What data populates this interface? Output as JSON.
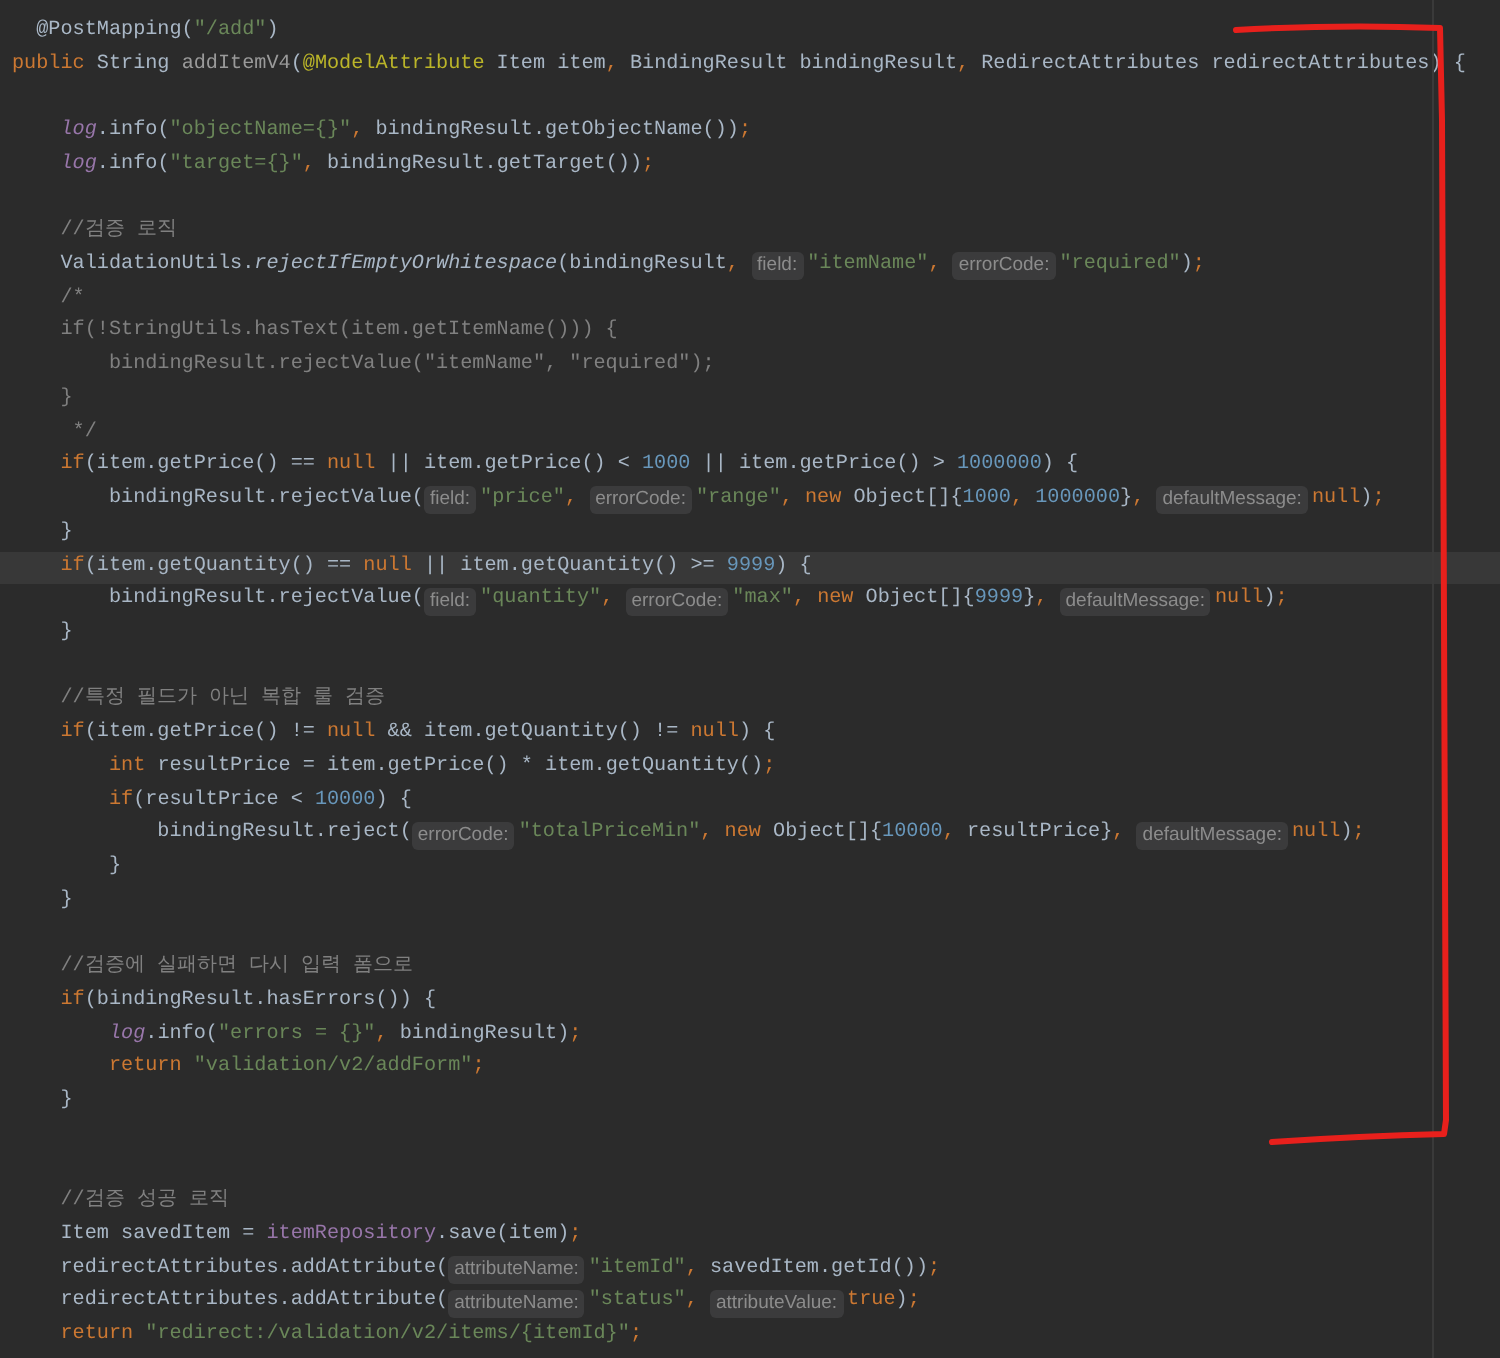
{
  "editor": {
    "lines": [
      {
        "current": false,
        "tokens": [
          {
            "kind": "plain",
            "text": "  @PostMapping("
          },
          {
            "kind": "str",
            "text": "\"/add\""
          },
          {
            "kind": "plain",
            "text": ")"
          }
        ]
      },
      {
        "current": false,
        "tokens": [
          {
            "kind": "kw",
            "text": "public"
          },
          {
            "kind": "plain",
            "text": " String "
          },
          {
            "kind": "dim",
            "text": "addItemV4"
          },
          {
            "kind": "plain",
            "text": "("
          },
          {
            "kind": "anno",
            "text": "@ModelAttribute"
          },
          {
            "kind": "plain",
            "text": " Item item"
          },
          {
            "kind": "kw",
            "text": ", "
          },
          {
            "kind": "plain",
            "text": "BindingResult bindingResult"
          },
          {
            "kind": "kw",
            "text": ", "
          },
          {
            "kind": "plain",
            "text": "RedirectAttributes redirectAttributes) {"
          }
        ]
      },
      {
        "current": false
      },
      {
        "current": false,
        "tokens": [
          {
            "kind": "field",
            "text": "    log"
          },
          {
            "kind": "plain",
            "text": ".info("
          },
          {
            "kind": "str",
            "text": "\"objectName={}\""
          },
          {
            "kind": "kw",
            "text": ", "
          },
          {
            "kind": "plain",
            "text": "bindingResult.getObjectName())"
          },
          {
            "kind": "kw",
            "text": ";"
          }
        ]
      },
      {
        "current": false,
        "tokens": [
          {
            "kind": "field",
            "text": "    log"
          },
          {
            "kind": "plain",
            "text": ".info("
          },
          {
            "kind": "str",
            "text": "\"target={}\""
          },
          {
            "kind": "kw",
            "text": ", "
          },
          {
            "kind": "plain",
            "text": "bindingResult.getTarget())"
          },
          {
            "kind": "kw",
            "text": ";"
          }
        ]
      },
      {
        "current": false
      },
      {
        "current": false,
        "tokens": [
          {
            "kind": "com",
            "text": "    //검증 로직"
          }
        ]
      },
      {
        "current": false,
        "tokens": [
          {
            "kind": "plain",
            "text": "    ValidationUtils."
          },
          {
            "kind": "italic",
            "text": "rejectIfEmptyOrWhitespace"
          },
          {
            "kind": "plain",
            "text": "(bindingResult"
          },
          {
            "kind": "kw",
            "text": ", "
          },
          {
            "kind": "hint",
            "text": "field:"
          },
          {
            "kind": "str",
            "text": "\"itemName\""
          },
          {
            "kind": "kw",
            "text": ", "
          },
          {
            "kind": "hint",
            "text": "errorCode:"
          },
          {
            "kind": "str",
            "text": "\"required\""
          },
          {
            "kind": "plain",
            "text": ")"
          },
          {
            "kind": "kw",
            "text": ";"
          }
        ]
      },
      {
        "current": false,
        "tokens": [
          {
            "kind": "com",
            "text": "    /*"
          }
        ]
      },
      {
        "current": false,
        "tokens": [
          {
            "kind": "com",
            "text": "    if(!StringUtils.hasText(item.getItemName())) {"
          }
        ]
      },
      {
        "current": false,
        "tokens": [
          {
            "kind": "com",
            "text": "        bindingResult.rejectValue(\"itemName\", \"required\");"
          }
        ]
      },
      {
        "current": false,
        "tokens": [
          {
            "kind": "com",
            "text": "    }"
          }
        ]
      },
      {
        "current": false,
        "tokens": [
          {
            "kind": "com",
            "text": "     */"
          }
        ]
      },
      {
        "current": false,
        "tokens": [
          {
            "kind": "kw",
            "text": "    if"
          },
          {
            "kind": "plain",
            "text": "(item.getPrice() == "
          },
          {
            "kind": "kw",
            "text": "null"
          },
          {
            "kind": "plain",
            "text": " || item.getPrice() < "
          },
          {
            "kind": "num",
            "text": "1000"
          },
          {
            "kind": "plain",
            "text": " || item.getPrice() > "
          },
          {
            "kind": "num",
            "text": "1000000"
          },
          {
            "kind": "plain",
            "text": ") {"
          }
        ]
      },
      {
        "current": false,
        "tokens": [
          {
            "kind": "plain",
            "text": "        bindingResult.rejectValue("
          },
          {
            "kind": "hint",
            "text": "field:"
          },
          {
            "kind": "str",
            "text": "\"price\""
          },
          {
            "kind": "kw",
            "text": ", "
          },
          {
            "kind": "hint",
            "text": "errorCode:"
          },
          {
            "kind": "str",
            "text": "\"range\""
          },
          {
            "kind": "kw",
            "text": ", new"
          },
          {
            "kind": "plain",
            "text": " Object[]{"
          },
          {
            "kind": "num",
            "text": "1000"
          },
          {
            "kind": "kw",
            "text": ", "
          },
          {
            "kind": "num",
            "text": "1000000"
          },
          {
            "kind": "plain",
            "text": "}"
          },
          {
            "kind": "kw",
            "text": ", "
          },
          {
            "kind": "hint",
            "text": "defaultMessage:"
          },
          {
            "kind": "kw",
            "text": "null"
          },
          {
            "kind": "plain",
            "text": ")"
          },
          {
            "kind": "kw",
            "text": ";"
          }
        ]
      },
      {
        "current": false,
        "tokens": [
          {
            "kind": "plain",
            "text": "    }"
          }
        ]
      },
      {
        "current": true,
        "tokens": [
          {
            "kind": "kw",
            "text": "    if"
          },
          {
            "kind": "plain",
            "text": "(item.getQuantity() == "
          },
          {
            "kind": "kw",
            "text": "null"
          },
          {
            "kind": "plain",
            "text": " || item.getQuantity() >= "
          },
          {
            "kind": "num",
            "text": "9999"
          },
          {
            "kind": "plain",
            "text": ") {"
          }
        ]
      },
      {
        "current": false,
        "tokens": [
          {
            "kind": "plain",
            "text": "        bindingResult.rejectValue("
          },
          {
            "kind": "hint",
            "text": "field:"
          },
          {
            "kind": "str",
            "text": "\"quantity\""
          },
          {
            "kind": "kw",
            "text": ", "
          },
          {
            "kind": "hint",
            "text": "errorCode:"
          },
          {
            "kind": "str",
            "text": "\"max\""
          },
          {
            "kind": "kw",
            "text": ", new"
          },
          {
            "kind": "plain",
            "text": " Object[]{"
          },
          {
            "kind": "num",
            "text": "9999"
          },
          {
            "kind": "plain",
            "text": "}"
          },
          {
            "kind": "kw",
            "text": ", "
          },
          {
            "kind": "hint",
            "text": "defaultMessage:"
          },
          {
            "kind": "kw",
            "text": "null"
          },
          {
            "kind": "plain",
            "text": ")"
          },
          {
            "kind": "kw",
            "text": ";"
          }
        ]
      },
      {
        "current": false,
        "tokens": [
          {
            "kind": "plain",
            "text": "    }"
          }
        ]
      },
      {
        "current": false
      },
      {
        "current": false,
        "tokens": [
          {
            "kind": "com",
            "text": "    //특정 필드가 아닌 복합 룰 검증"
          }
        ]
      },
      {
        "current": false,
        "tokens": [
          {
            "kind": "kw",
            "text": "    if"
          },
          {
            "kind": "plain",
            "text": "(item.getPrice() != "
          },
          {
            "kind": "kw",
            "text": "null"
          },
          {
            "kind": "plain",
            "text": " && item.getQuantity() != "
          },
          {
            "kind": "kw",
            "text": "null"
          },
          {
            "kind": "plain",
            "text": ") {"
          }
        ]
      },
      {
        "current": false,
        "tokens": [
          {
            "kind": "kw",
            "text": "        int"
          },
          {
            "kind": "plain",
            "text": " resultPrice = item.getPrice() * item.getQuantity()"
          },
          {
            "kind": "kw",
            "text": ";"
          }
        ]
      },
      {
        "current": false,
        "tokens": [
          {
            "kind": "kw",
            "text": "        if"
          },
          {
            "kind": "plain",
            "text": "(resultPrice < "
          },
          {
            "kind": "num",
            "text": "10000"
          },
          {
            "kind": "plain",
            "text": ") {"
          }
        ]
      },
      {
        "current": false,
        "tokens": [
          {
            "kind": "plain",
            "text": "            bindingResult.reject("
          },
          {
            "kind": "hint",
            "text": "errorCode:"
          },
          {
            "kind": "str",
            "text": "\"totalPriceMin\""
          },
          {
            "kind": "kw",
            "text": ", new"
          },
          {
            "kind": "plain",
            "text": " Object[]{"
          },
          {
            "kind": "num",
            "text": "10000"
          },
          {
            "kind": "kw",
            "text": ", "
          },
          {
            "kind": "plain",
            "text": "resultPrice}"
          },
          {
            "kind": "kw",
            "text": ", "
          },
          {
            "kind": "hint",
            "text": "defaultMessage:"
          },
          {
            "kind": "kw",
            "text": "null"
          },
          {
            "kind": "plain",
            "text": ")"
          },
          {
            "kind": "kw",
            "text": ";"
          }
        ]
      },
      {
        "current": false,
        "tokens": [
          {
            "kind": "plain",
            "text": "        }"
          }
        ]
      },
      {
        "current": false,
        "tokens": [
          {
            "kind": "plain",
            "text": "    }"
          }
        ]
      },
      {
        "current": false
      },
      {
        "current": false,
        "tokens": [
          {
            "kind": "com",
            "text": "    //검증에 실패하면 다시 입력 폼으로"
          }
        ]
      },
      {
        "current": false,
        "tokens": [
          {
            "kind": "kw",
            "text": "    if"
          },
          {
            "kind": "plain",
            "text": "(bindingResult.hasErrors()) {"
          }
        ]
      },
      {
        "current": false,
        "tokens": [
          {
            "kind": "field",
            "text": "        log"
          },
          {
            "kind": "plain",
            "text": ".info("
          },
          {
            "kind": "str",
            "text": "\"errors = {}\""
          },
          {
            "kind": "kw",
            "text": ", "
          },
          {
            "kind": "plain",
            "text": "bindingResult)"
          },
          {
            "kind": "kw",
            "text": ";"
          }
        ]
      },
      {
        "current": false,
        "tokens": [
          {
            "kind": "kw",
            "text": "        return"
          },
          {
            "kind": "str",
            "text": " \"validation/v2/addForm\""
          },
          {
            "kind": "kw",
            "text": ";"
          }
        ]
      },
      {
        "current": false,
        "tokens": [
          {
            "kind": "plain",
            "text": "    }"
          }
        ]
      },
      {
        "current": false
      },
      {
        "current": false
      },
      {
        "current": false,
        "tokens": [
          {
            "kind": "com",
            "text": "    //검증 성공 로직"
          }
        ]
      },
      {
        "current": false,
        "tokens": [
          {
            "kind": "plain",
            "text": "    Item savedItem = "
          },
          {
            "kind": "member",
            "text": "itemRepository"
          },
          {
            "kind": "plain",
            "text": ".save(item)"
          },
          {
            "kind": "kw",
            "text": ";"
          }
        ]
      },
      {
        "current": false,
        "tokens": [
          {
            "kind": "plain",
            "text": "    redirectAttributes.addAttribute("
          },
          {
            "kind": "hint",
            "text": "attributeName:"
          },
          {
            "kind": "str",
            "text": "\"itemId\""
          },
          {
            "kind": "kw",
            "text": ", "
          },
          {
            "kind": "plain",
            "text": "savedItem.getId())"
          },
          {
            "kind": "kw",
            "text": ";"
          }
        ]
      },
      {
        "current": false,
        "tokens": [
          {
            "kind": "plain",
            "text": "    redirectAttributes.addAttribute("
          },
          {
            "kind": "hint",
            "text": "attributeName:"
          },
          {
            "kind": "str",
            "text": "\"status\""
          },
          {
            "kind": "kw",
            "text": ", "
          },
          {
            "kind": "hint",
            "text": "attributeValue:"
          },
          {
            "kind": "kw",
            "text": "true"
          },
          {
            "kind": "plain",
            "text": ")"
          },
          {
            "kind": "kw",
            "text": ";"
          }
        ]
      },
      {
        "current": false,
        "tokens": [
          {
            "kind": "kw",
            "text": "    return"
          },
          {
            "kind": "str",
            "text": " \"redirect:/validation/v2/items/{itemId}\""
          },
          {
            "kind": "kw",
            "text": ";"
          }
        ]
      }
    ]
  }
}
